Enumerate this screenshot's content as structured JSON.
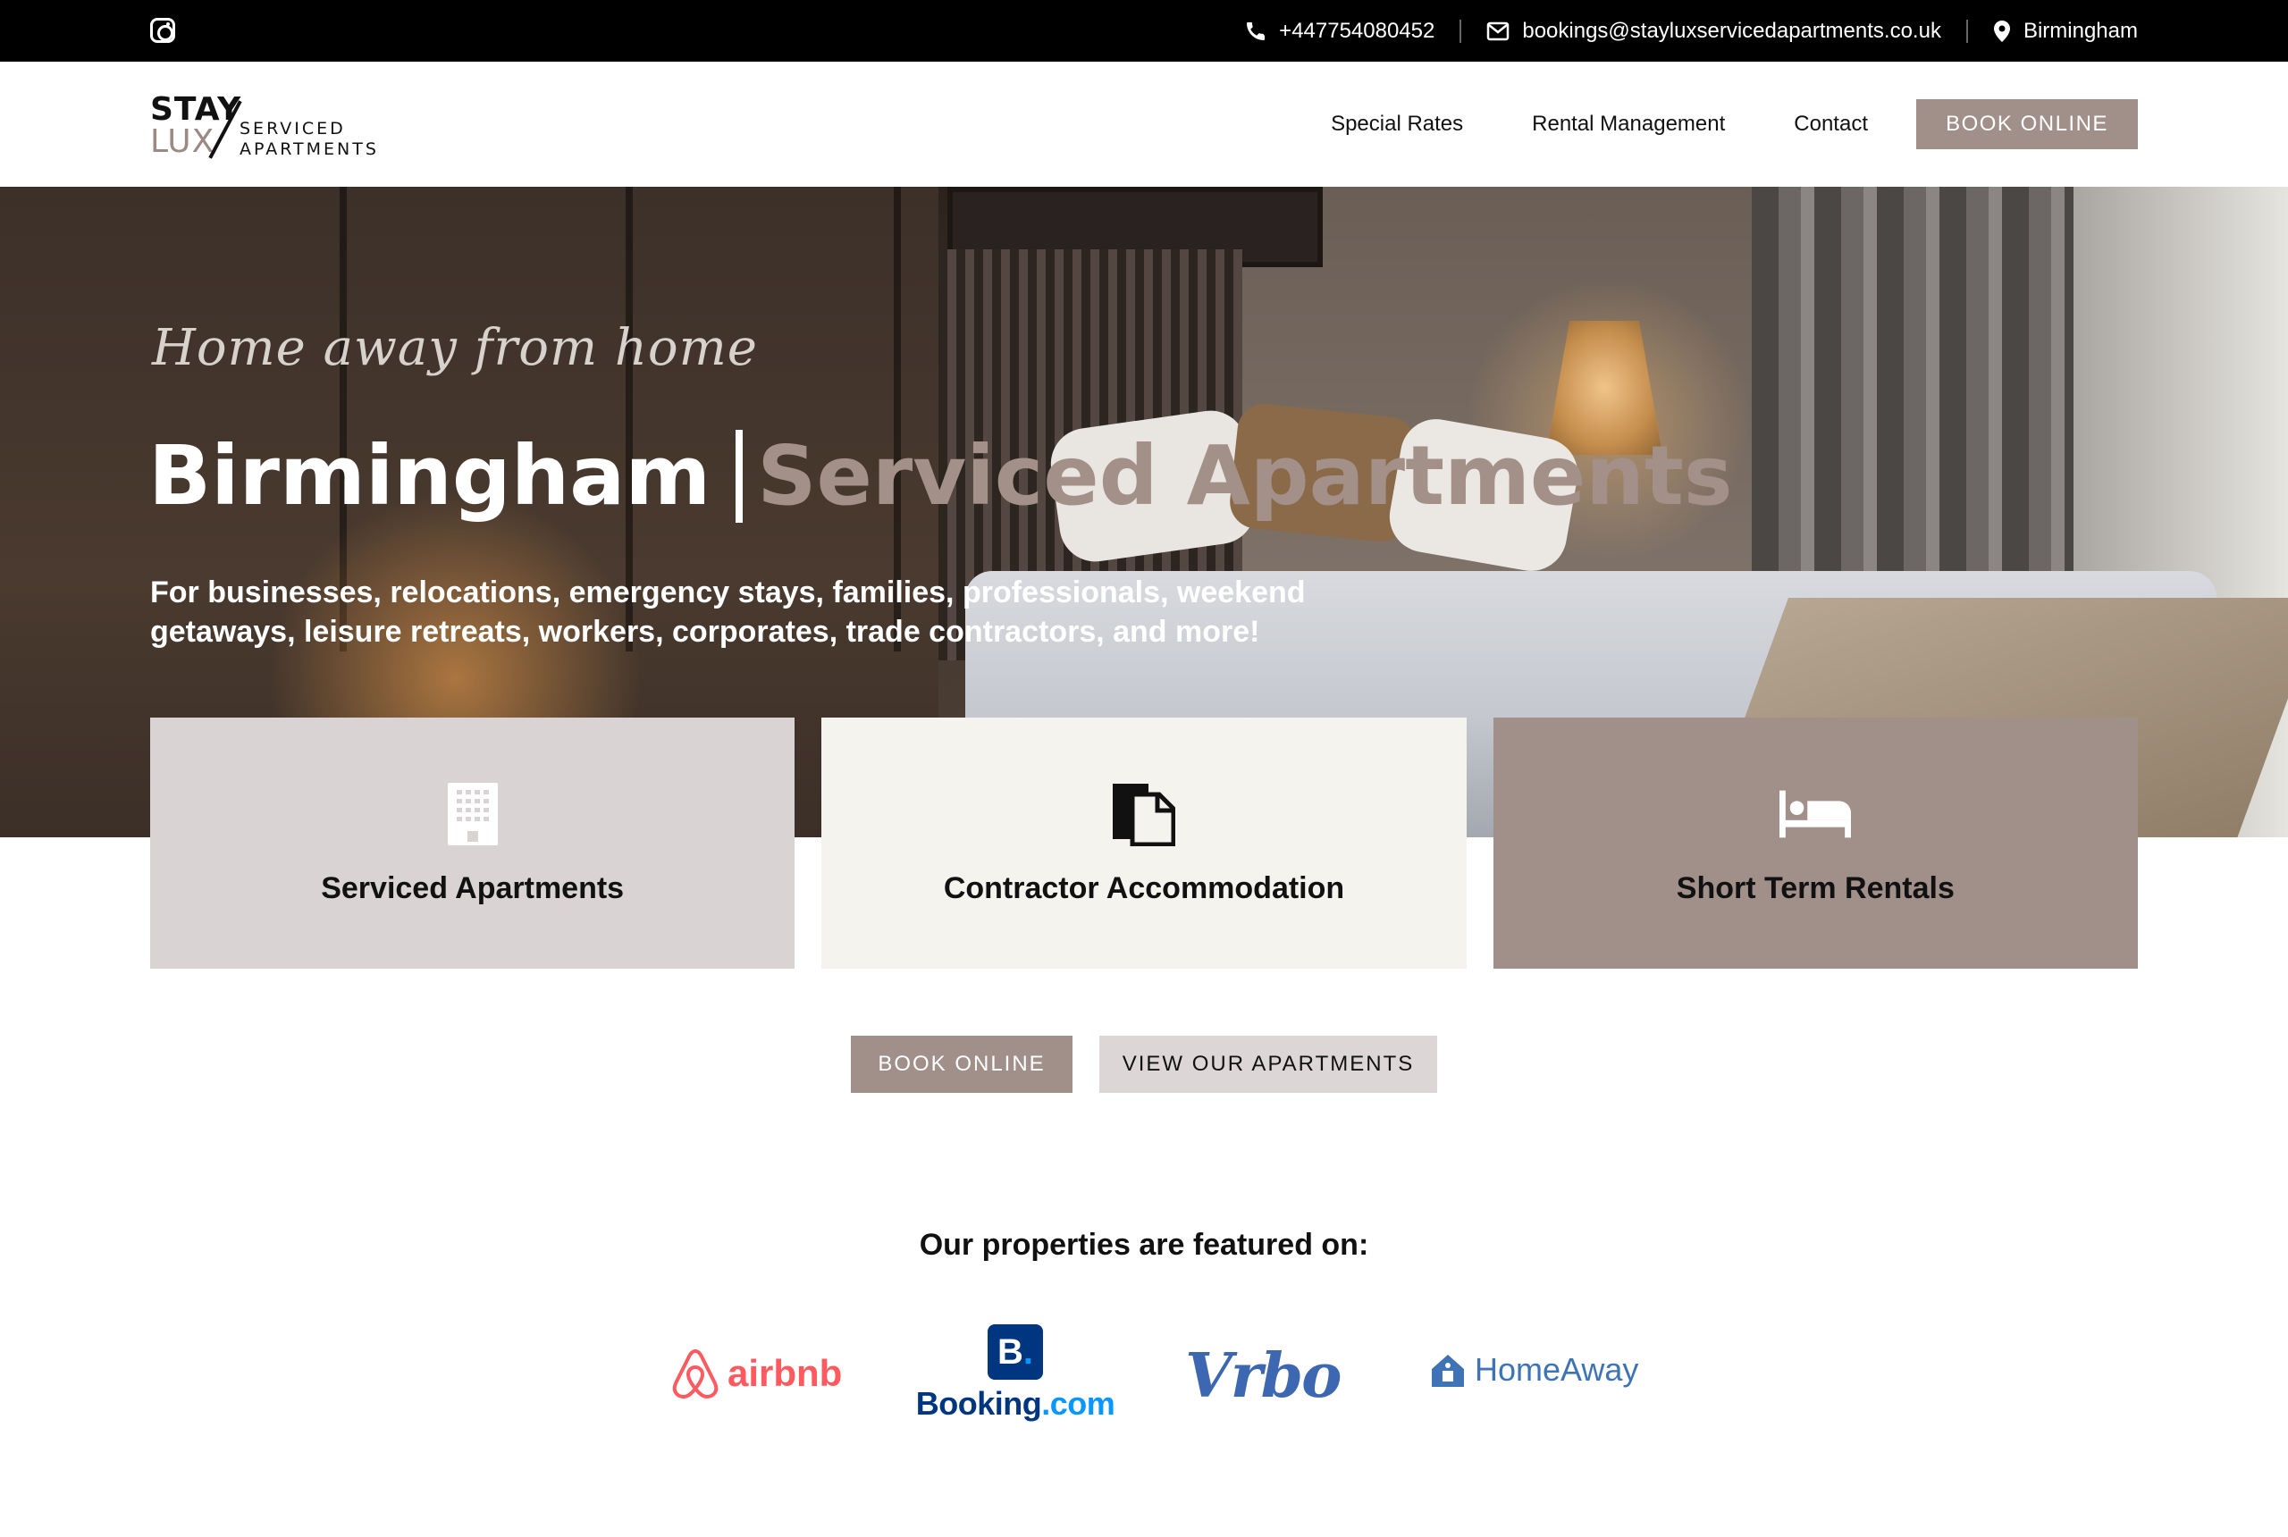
{
  "topbar": {
    "phone": "+447754080452",
    "email": "bookings@stayluxservicedapartments.co.uk",
    "location": "Birmingham",
    "icons": [
      "instagram-icon",
      "phone-icon",
      "mail-icon",
      "map-pin-icon"
    ]
  },
  "logo": {
    "line1": "STAY",
    "line2": "LUX",
    "sub1": "SERVICED",
    "sub2": "APARTMENTS"
  },
  "nav": {
    "items": [
      {
        "label": "Special Rates"
      },
      {
        "label": "Rental Management"
      },
      {
        "label": "Contact"
      }
    ],
    "book_label": "BOOK ONLINE"
  },
  "hero": {
    "tagline": "Home away from home",
    "title_main": "Birmingham",
    "title_accent": "Serviced Apartments",
    "description": "For businesses, relocations, emergency stays, families, professionals, weekend getaways, leisure retreats, workers, corporates, trade contractors, and more!"
  },
  "cards": [
    {
      "label": "Serviced Apartments",
      "icon": "building-icon"
    },
    {
      "label": "Contractor Accommodation",
      "icon": "documents-icon"
    },
    {
      "label": "Short Term Rentals",
      "icon": "bed-icon"
    }
  ],
  "ctas": {
    "primary": "BOOK ONLINE",
    "secondary": "VIEW OUR APARTMENTS"
  },
  "featured": {
    "title": "Our properties are featured on:",
    "logos": {
      "airbnb": "airbnb",
      "booking_b": "B",
      "booking_word": "Booking",
      "booking_tld": ".com",
      "vrbo": "Vrbo",
      "homeaway": "HomeAway"
    }
  },
  "colors": {
    "accent": "#a09089",
    "card1": "#d9d4d3",
    "card2": "#f5f3ee",
    "card3": "#a09089",
    "topbar": "#000000"
  }
}
